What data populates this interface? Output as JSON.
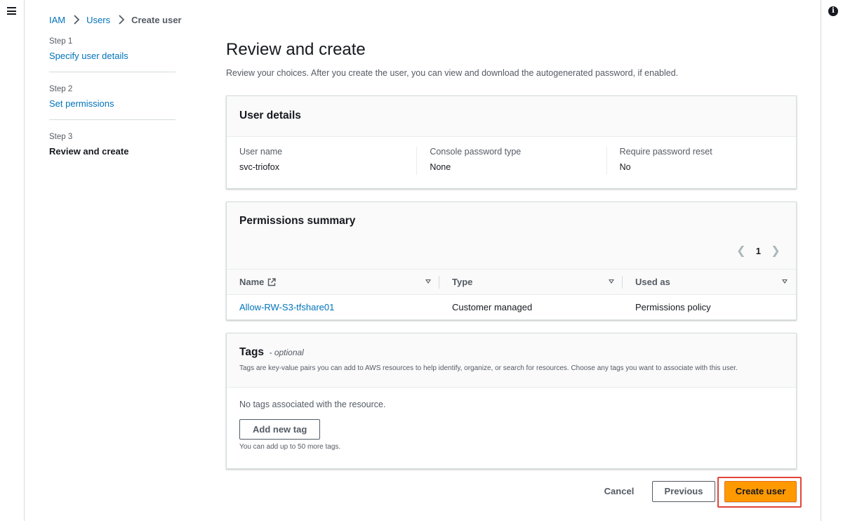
{
  "breadcrumb": [
    {
      "label": "IAM"
    },
    {
      "label": "Users"
    },
    {
      "label": "Create user"
    }
  ],
  "steps": [
    {
      "num": "Step 1",
      "title": "Specify user details",
      "active": false
    },
    {
      "num": "Step 2",
      "title": "Set permissions",
      "active": false
    },
    {
      "num": "Step 3",
      "title": "Review and create",
      "active": true
    }
  ],
  "page": {
    "title": "Review and create",
    "description": "Review your choices. After you create the user, you can view and download the autogenerated password, if enabled."
  },
  "user_details": {
    "title": "User details",
    "fields": [
      {
        "label": "User name",
        "value": "svc-triofox"
      },
      {
        "label": "Console password type",
        "value": "None"
      },
      {
        "label": "Require password reset",
        "value": "No"
      }
    ]
  },
  "permissions": {
    "title": "Permissions summary",
    "page": "1",
    "columns": [
      "Name",
      "Type",
      "Used as"
    ],
    "rows": [
      {
        "name": "Allow-RW-S3-tfshare01",
        "type": "Customer managed",
        "used_as": "Permissions policy"
      }
    ]
  },
  "tags": {
    "title": "Tags",
    "optional": "- optional",
    "description": "Tags are key-value pairs you can add to AWS resources to help identify, organize, or search for resources. Choose any tags you want to associate with this user.",
    "empty": "No tags associated with the resource.",
    "add_button": "Add new tag",
    "hint": "You can add up to 50 more tags."
  },
  "actions": {
    "cancel": "Cancel",
    "previous": "Previous",
    "create": "Create user"
  },
  "icons": {
    "menu": "hamburger-menu-icon",
    "info": "info-icon",
    "external": "external-link-icon",
    "sort": "sort-caret-icon"
  },
  "colors": {
    "link": "#0073bb",
    "primary_button": "#ff9900",
    "highlight_box": "#e0453a"
  }
}
